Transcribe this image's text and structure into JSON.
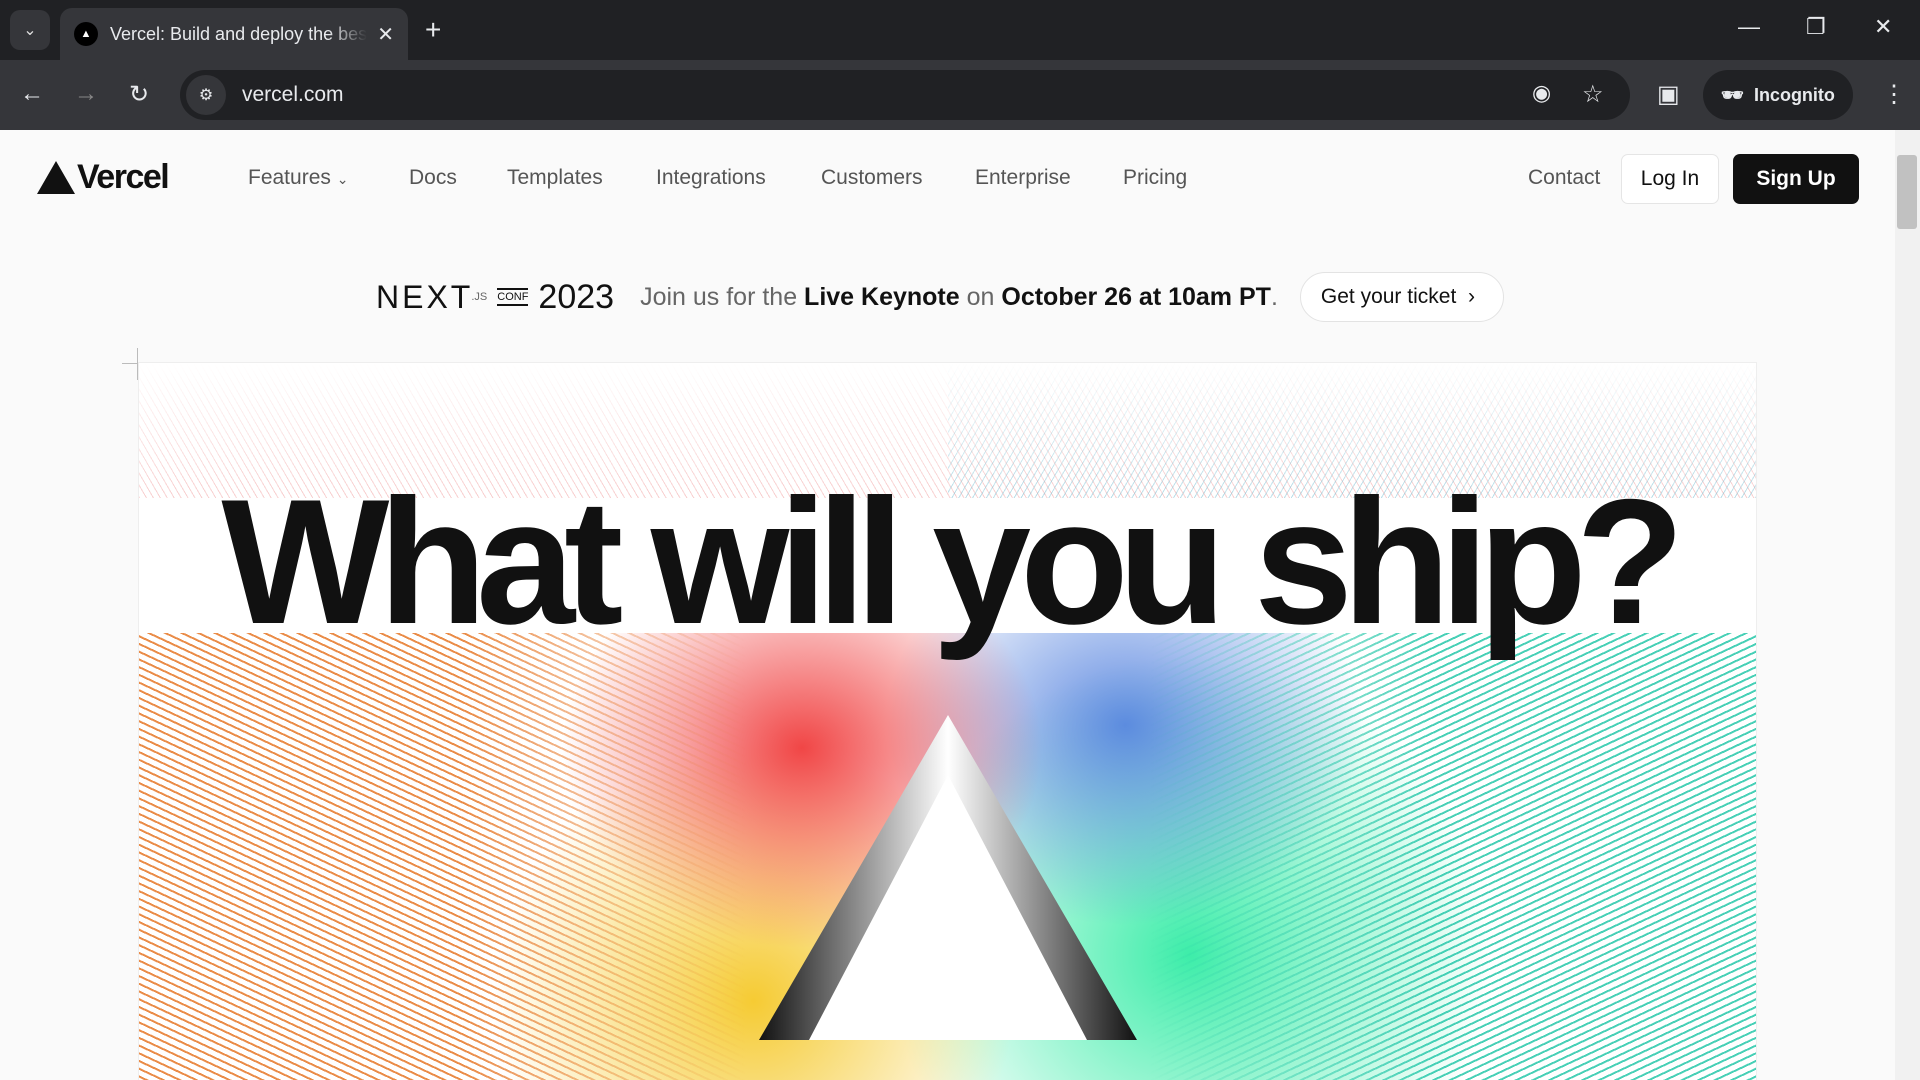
{
  "browser": {
    "tab_title": "Vercel: Build and deploy the best web experiences",
    "url": "vercel.com",
    "incognito_label": "Incognito"
  },
  "nav": {
    "brand": "Vercel",
    "links": [
      "Features",
      "Docs",
      "Templates",
      "Integrations",
      "Customers",
      "Enterprise",
      "Pricing"
    ],
    "contact": "Contact",
    "login": "Log In",
    "signup": "Sign Up"
  },
  "banner": {
    "logo_text": "NEXT",
    "logo_js": ".JS",
    "logo_conf": "CONF",
    "year": "2023",
    "pre": "Join us for the",
    "live": "Live Keynote",
    "mid": "on",
    "date": "October 26 at 10am PT",
    "end": ".",
    "cta": "Get your ticket"
  },
  "hero": {
    "headline": "What will you ship?"
  }
}
